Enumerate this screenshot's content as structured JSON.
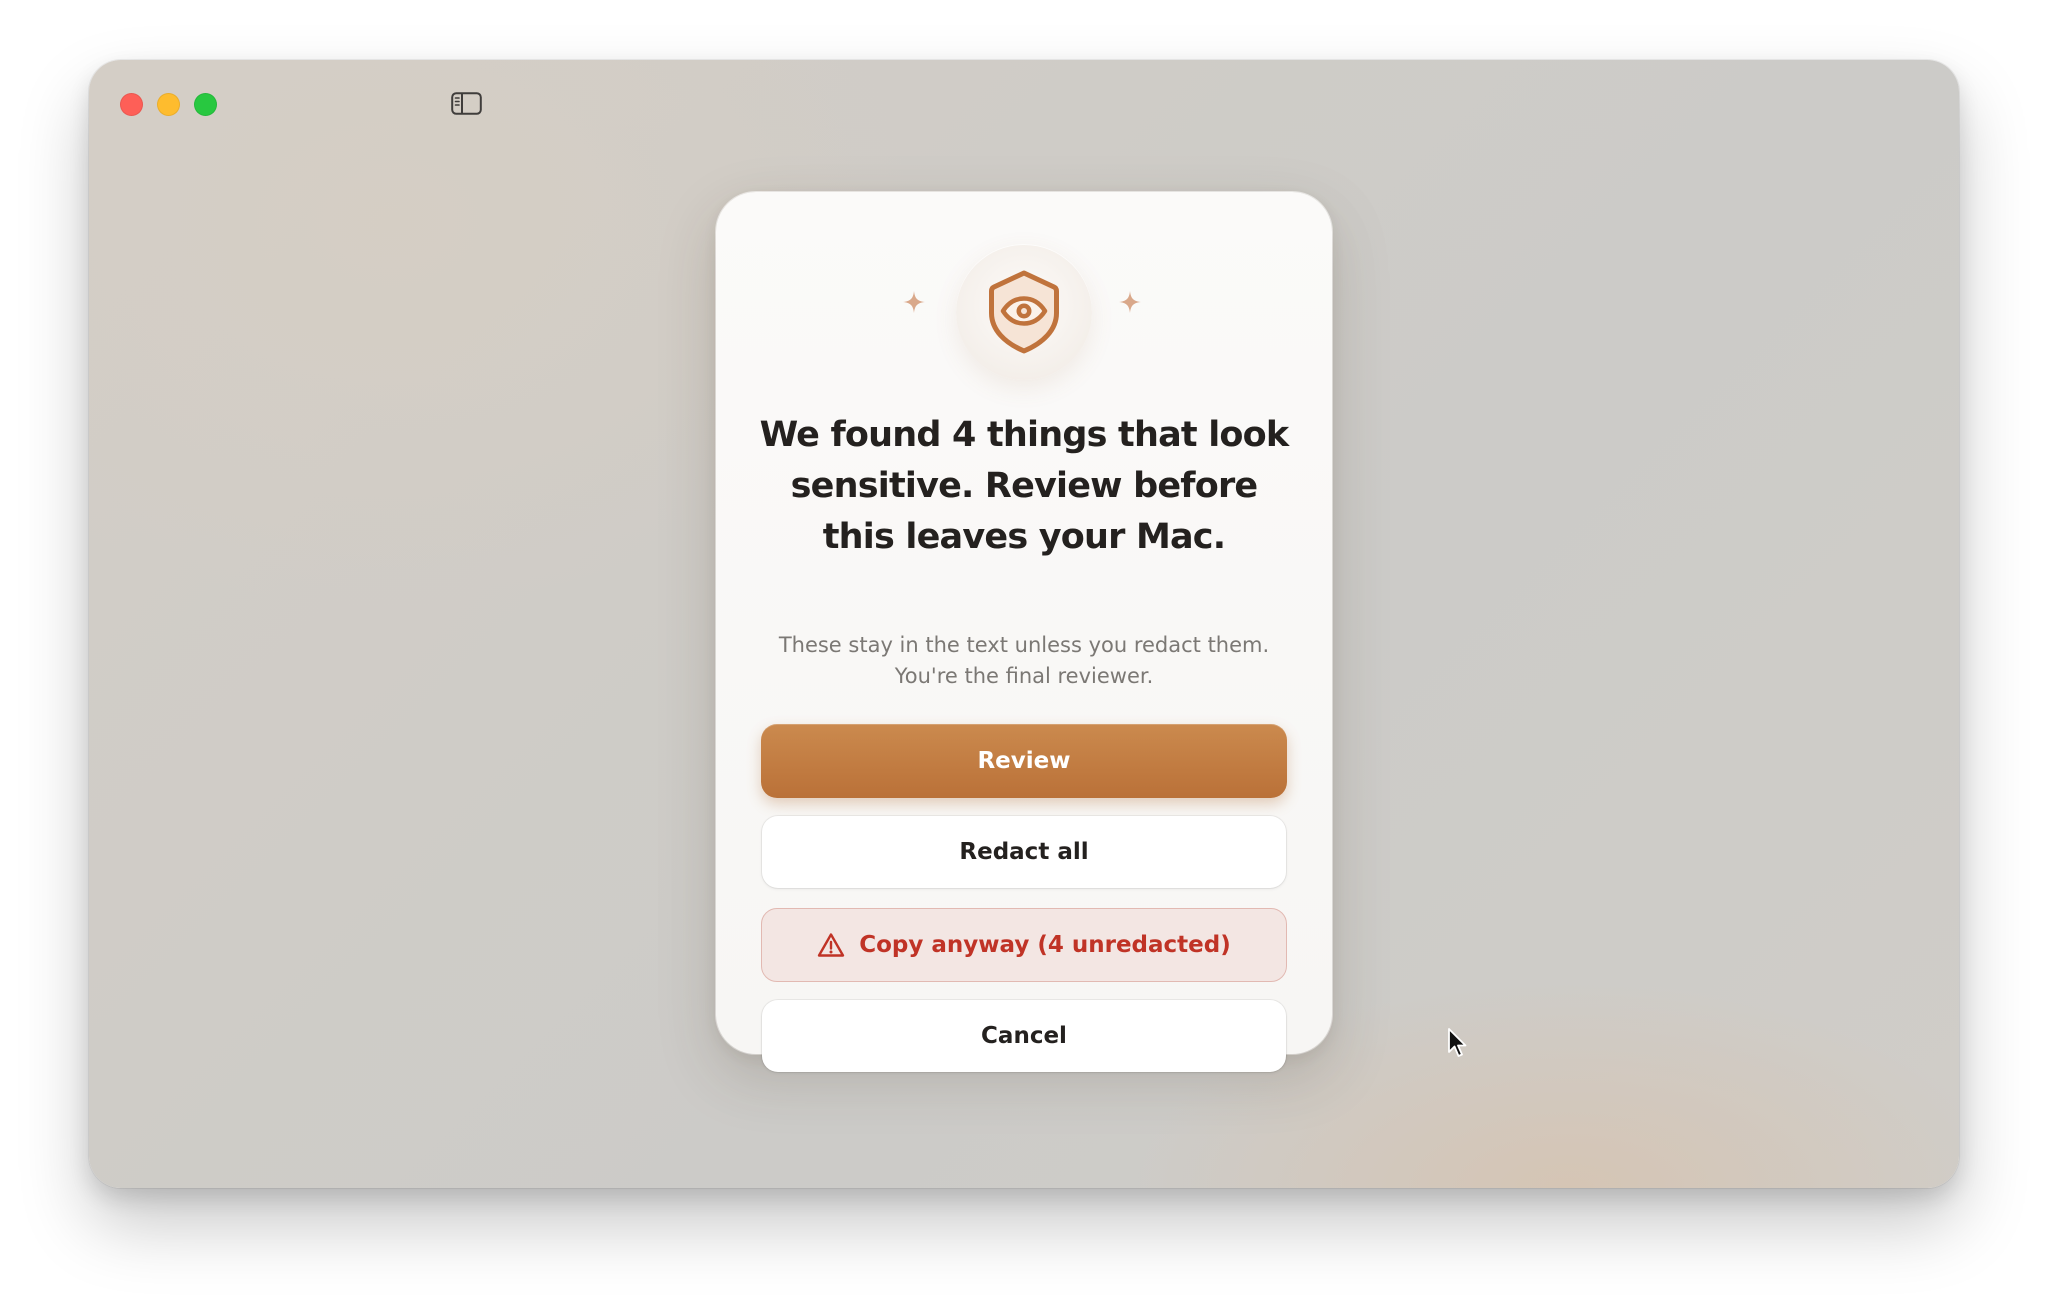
{
  "window": {
    "controls": [
      "close",
      "minimize",
      "zoom"
    ],
    "toolbar_icon": "sidebar-toggle-icon"
  },
  "dialog": {
    "icon": "shield-eye-icon",
    "decorations": [
      "sparkle-icon",
      "sparkle-icon"
    ],
    "title": "We found 4 things that look sensitive. Review before this leaves your Mac.",
    "subtitle_line1": "These stay in the text unless you redact them.",
    "subtitle_line2": "You're the final reviewer.",
    "buttons": {
      "review": "Review",
      "redact_all": "Redact all",
      "copy_anyway": "Copy anyway (4 unredacted)",
      "cancel": "Cancel"
    }
  },
  "colors": {
    "accent": "#c07a40",
    "danger": "#c03326",
    "danger_bg": "#f3e6e3",
    "close": "#fe5f57",
    "minimize": "#febc2e",
    "zoom": "#28c840"
  }
}
